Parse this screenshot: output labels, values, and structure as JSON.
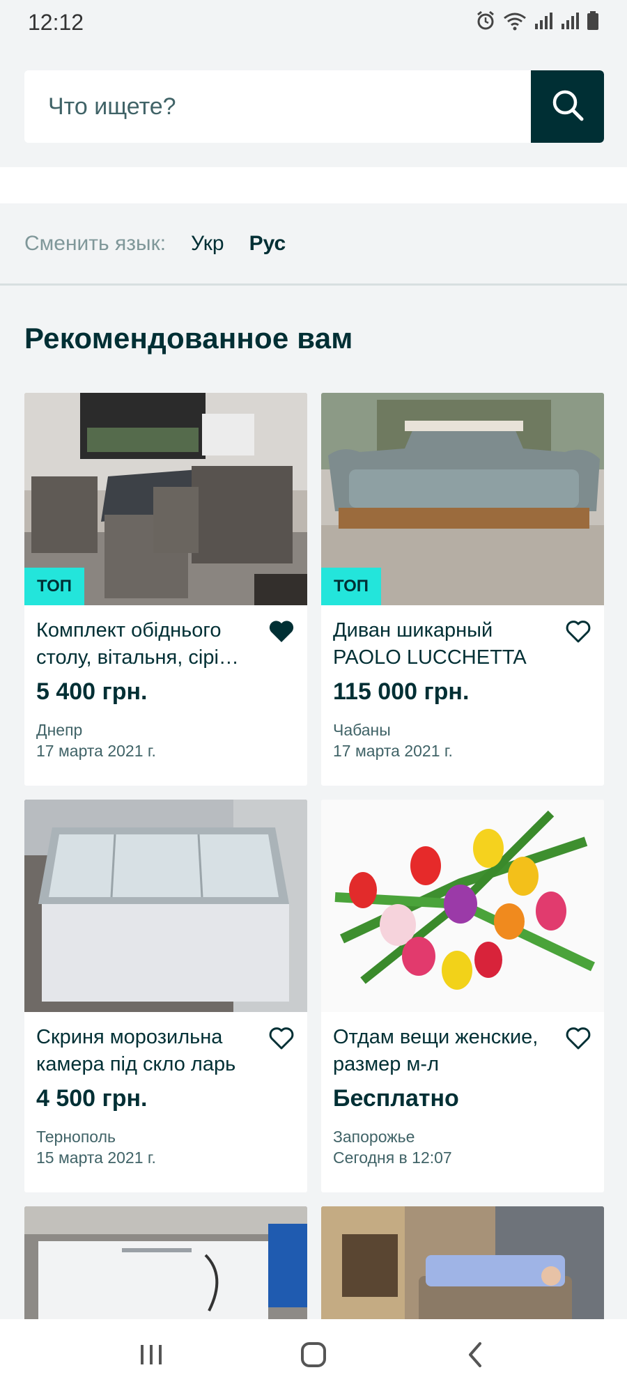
{
  "status": {
    "time": "12:12"
  },
  "search": {
    "placeholder": "Что ищете?"
  },
  "language": {
    "label": "Сменить язык:",
    "options": [
      "Укр",
      "Рус"
    ]
  },
  "section": {
    "title": "Рекомендованное вам"
  },
  "badge": "ТОП",
  "cards": [
    {
      "title": "Комплект обіднього столу, вітальня, сірі…",
      "price": "5 400 грн.",
      "city": "Днепр",
      "date": "17 марта 2021 г.",
      "top": true,
      "favorite": true
    },
    {
      "title": "Диван шикарный PAOLO LUCCHETTA",
      "price": "115 000 грн.",
      "city": "Чабаны",
      "date": "17 марта 2021 г.",
      "top": true,
      "favorite": false
    },
    {
      "title": "Скриня морозильна камера під скло ларь",
      "price": "4 500 грн.",
      "city": "Тернополь",
      "date": "15 марта 2021 г.",
      "top": false,
      "favorite": false
    },
    {
      "title": "Отдам вещи женские, размер м-л",
      "price": "Бесплатно",
      "city": "Запорожье",
      "date": "Сегодня в 12:07",
      "top": false,
      "favorite": false
    }
  ],
  "colors": {
    "brand_dark": "#002f34",
    "badge": "#23e5db",
    "background": "#f2f4f5"
  },
  "icons": {
    "search": "search-icon",
    "heart": "heart-icon",
    "heart_filled": "heart-filled-icon"
  }
}
